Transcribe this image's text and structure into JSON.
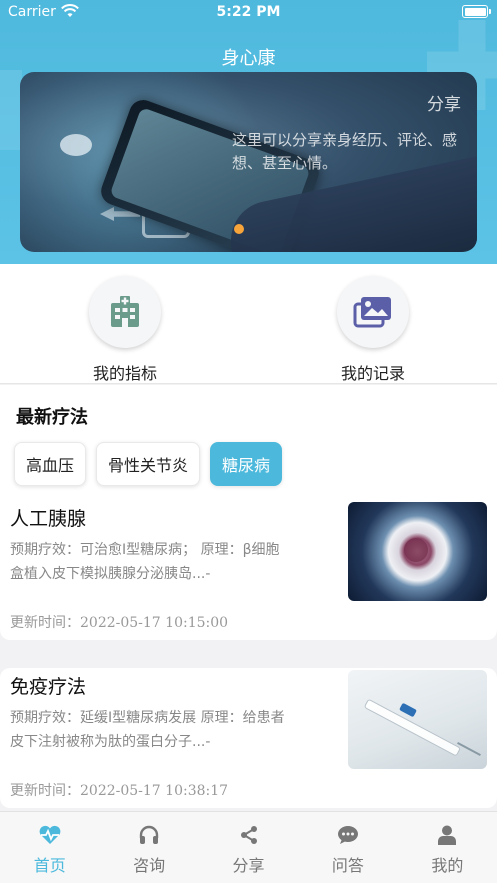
{
  "status_bar": {
    "carrier": "Carrier",
    "time": "5:22 PM"
  },
  "app": {
    "title": "身心康"
  },
  "banner": {
    "share_label": "分享",
    "description": "这里可以分享亲身经历、评论、感想、甚至心情。"
  },
  "quick_actions": [
    {
      "label": "我的指标",
      "icon": "hospital-icon"
    },
    {
      "label": "我的记录",
      "icon": "photo-album-icon"
    }
  ],
  "latest_therapies": {
    "title": "最新疗法",
    "categories": [
      "高血压",
      "骨性关节炎",
      "糖尿病"
    ],
    "selected": "糖尿病",
    "items": [
      {
        "title": "人工胰腺",
        "description": "预期疗效：可治愈I型糖尿病； 原理：β细胞盒植入皮下模拟胰腺分泌胰岛...-",
        "updated_label": "更新时间：",
        "updated_time": "2022-05-17 10:15:00"
      },
      {
        "title": "免疫疗法",
        "description": "预期疗效：延缓I型糖尿病发展 原理：给患者皮下注射被称为肽的蛋白分子...-",
        "updated_label": "更新时间：",
        "updated_time": "2022-05-17 10:38:17"
      }
    ]
  },
  "tabbar": [
    {
      "label": "首页",
      "icon": "heartbeat-icon",
      "active": true
    },
    {
      "label": "咨询",
      "icon": "headphones-icon",
      "active": false
    },
    {
      "label": "分享",
      "icon": "share-icon",
      "active": false
    },
    {
      "label": "问答",
      "icon": "chat-bubble-icon",
      "active": false
    },
    {
      "label": "我的",
      "icon": "user-icon",
      "active": false
    }
  ],
  "colors": {
    "accent": "#4cb9dc",
    "header": "#55bde0",
    "indicator_dot": "#f7a43a"
  }
}
